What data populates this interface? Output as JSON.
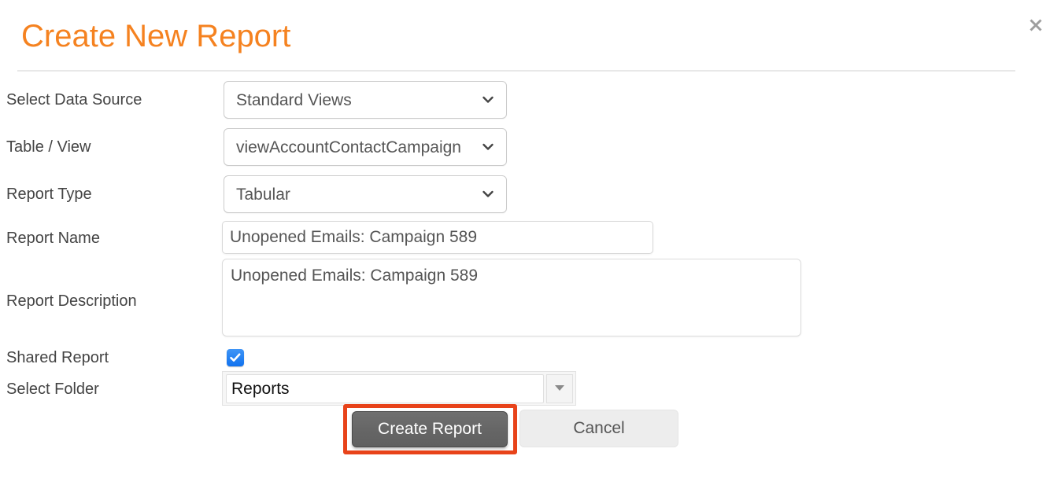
{
  "dialog": {
    "title": "Create New Report",
    "close_icon": "close-icon"
  },
  "fields": {
    "data_source": {
      "label": "Select Data Source",
      "value": "Standard Views",
      "icon": "chevron-down-icon"
    },
    "table_view": {
      "label": "Table / View",
      "value": "viewAccountContactCampaign",
      "icon": "chevron-down-icon"
    },
    "report_type": {
      "label": "Report Type",
      "value": "Tabular",
      "icon": "chevron-down-icon"
    },
    "report_name": {
      "label": "Report Name",
      "value": "Unopened Emails: Campaign 589",
      "placeholder": ""
    },
    "report_description": {
      "label": "Report Description",
      "value": "Unopened Emails: Campaign 589",
      "placeholder": ""
    },
    "shared_report": {
      "label": "Shared Report",
      "checked": true,
      "icon": "checkmark-icon"
    },
    "select_folder": {
      "label": "Select Folder",
      "value": "Reports",
      "placeholder": "",
      "icon": "triangle-down-icon"
    }
  },
  "actions": {
    "create_label": "Create Report",
    "cancel_label": "Cancel"
  },
  "colors": {
    "title_orange": "#F58220",
    "highlight_red": "#E8431A",
    "checkbox_blue": "#1072EF",
    "primary_button_gray": "#666666",
    "secondary_button_gray": "#ededed"
  }
}
